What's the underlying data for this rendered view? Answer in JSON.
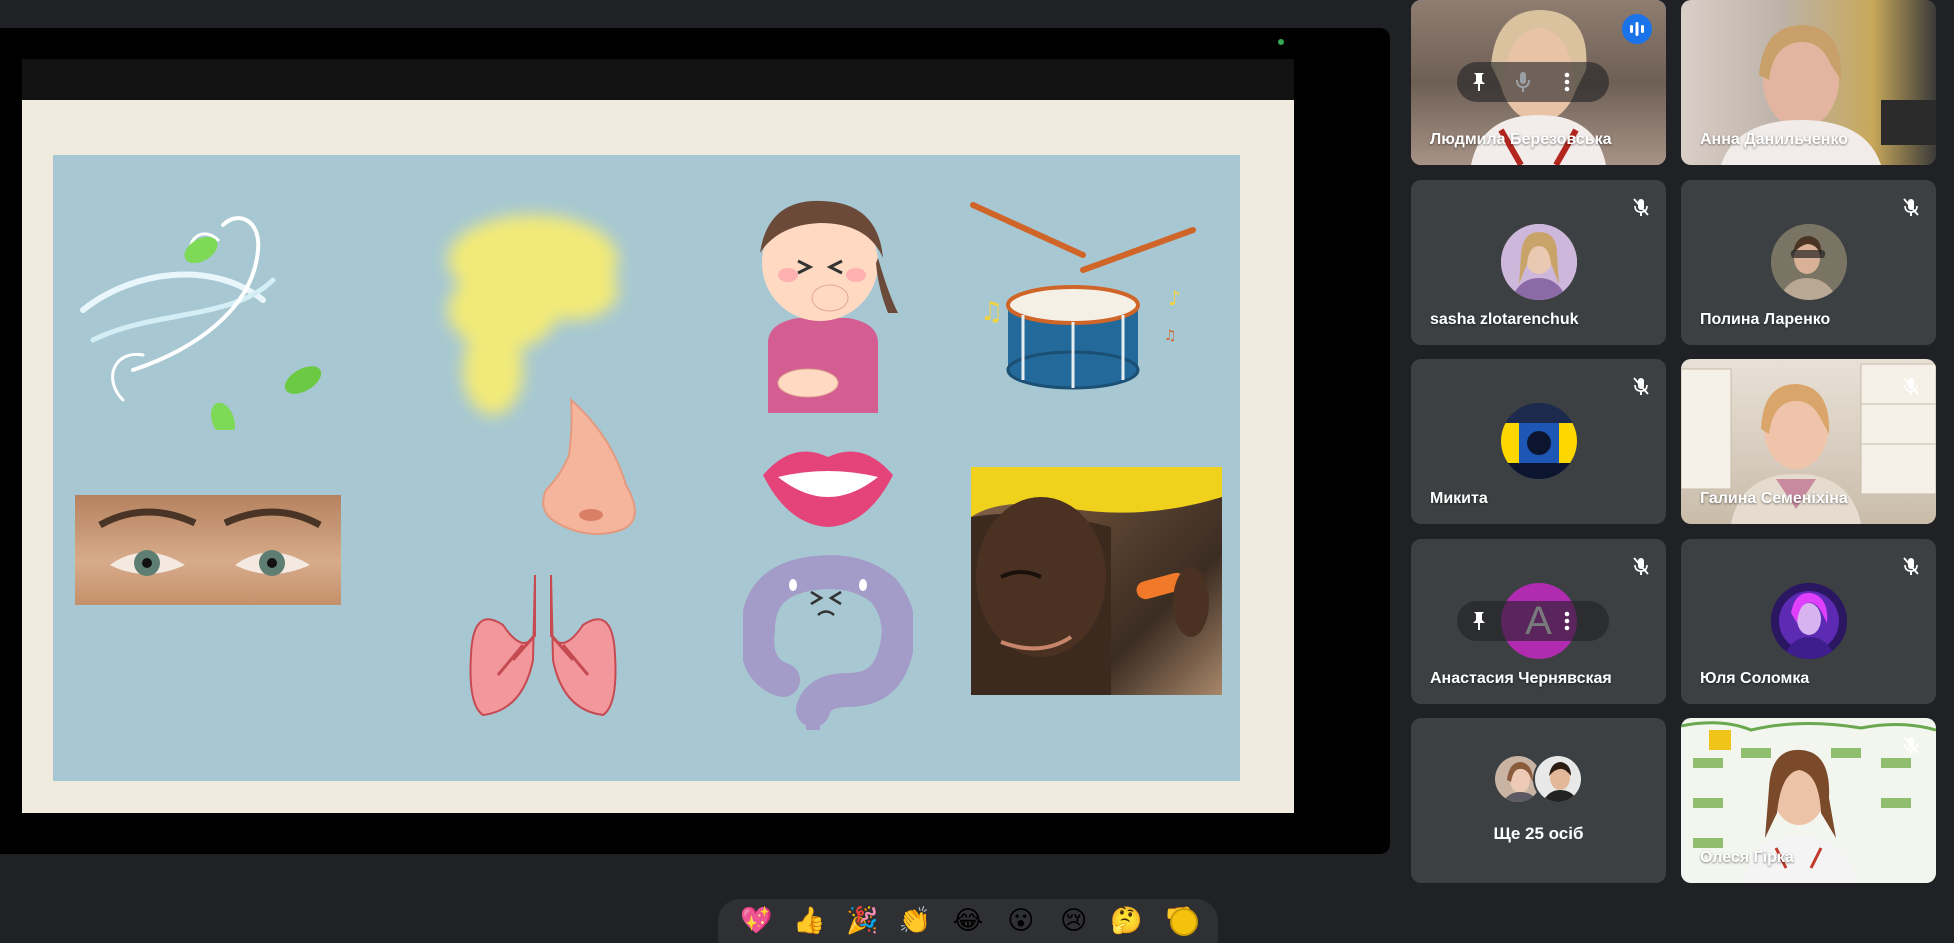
{
  "colors": {
    "page_bg": "#202124",
    "tile_bg": "#3c4043",
    "speaking_outline": "#8ab4f8",
    "slide_panel": "#a7c8d2",
    "slide_bg": "#f1ebdf"
  },
  "presentation": {
    "slide_items": [
      "wind-illustration",
      "yellow-smoke",
      "coughing-girl",
      "drum-and-sticks",
      "eyes-photo",
      "nose",
      "lips",
      "lungs",
      "sad-intestine",
      "worker-earplug-photo"
    ]
  },
  "participants": [
    {
      "name": "Людмила Березовська",
      "speaking": true,
      "has_hover_controls": true
    },
    {
      "name": "Анна Данильченко",
      "muted": false
    },
    {
      "name": "sasha zlotarenchuk",
      "muted": true
    },
    {
      "name": "Полина Ларенко",
      "muted": true
    },
    {
      "name": "Микита",
      "muted": true
    },
    {
      "name": "Галина Семеніхіна",
      "muted": true
    },
    {
      "name": "Анастасия Чернявская",
      "muted": true,
      "avatar_letter": "A",
      "has_hover_controls": true
    },
    {
      "name": "Юля Соломка",
      "muted": true
    },
    {
      "name": "Олеся Гірка",
      "muted": true
    }
  ],
  "others": {
    "label": "Ще 25 осіб"
  },
  "reactions": [
    {
      "icon": "sparkling-heart-icon",
      "glyph": "💖"
    },
    {
      "icon": "thumbs-up-icon",
      "glyph": "👍"
    },
    {
      "icon": "party-popper-icon",
      "glyph": "🎉"
    },
    {
      "icon": "clapping-hands-icon",
      "glyph": "👏"
    },
    {
      "icon": "tears-of-joy-icon",
      "glyph": "😂"
    },
    {
      "icon": "surprised-face-icon",
      "glyph": "😮"
    },
    {
      "icon": "crying-face-icon",
      "glyph": "😢"
    },
    {
      "icon": "thinking-face-icon",
      "glyph": "🤔"
    },
    {
      "icon": "thumbs-down-icon",
      "glyph": "👎"
    }
  ],
  "more_reactions_icon": "skin-tone-circle-icon"
}
